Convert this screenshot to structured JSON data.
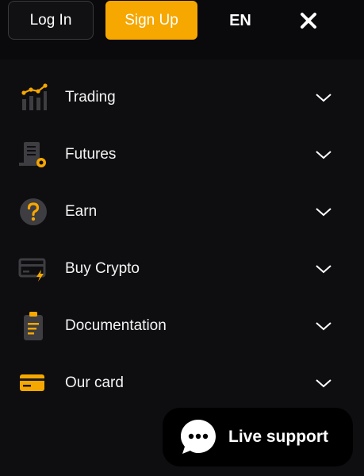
{
  "header": {
    "login_label": "Log In",
    "signup_label": "Sign Up",
    "language": "EN"
  },
  "menu": {
    "items": [
      {
        "label": "Trading",
        "icon": "trading-chart-icon"
      },
      {
        "label": "Futures",
        "icon": "futures-document-icon"
      },
      {
        "label": "Earn",
        "icon": "question-circle-icon"
      },
      {
        "label": "Buy Crypto",
        "icon": "credit-card-bolt-icon"
      },
      {
        "label": "Documentation",
        "icon": "clipboard-icon"
      },
      {
        "label": "Our card",
        "icon": "card-icon"
      }
    ]
  },
  "support": {
    "label": "Live support"
  },
  "colors": {
    "accent": "#f6a700",
    "background": "#0e0e10",
    "icon_gray": "#3d3d42"
  }
}
